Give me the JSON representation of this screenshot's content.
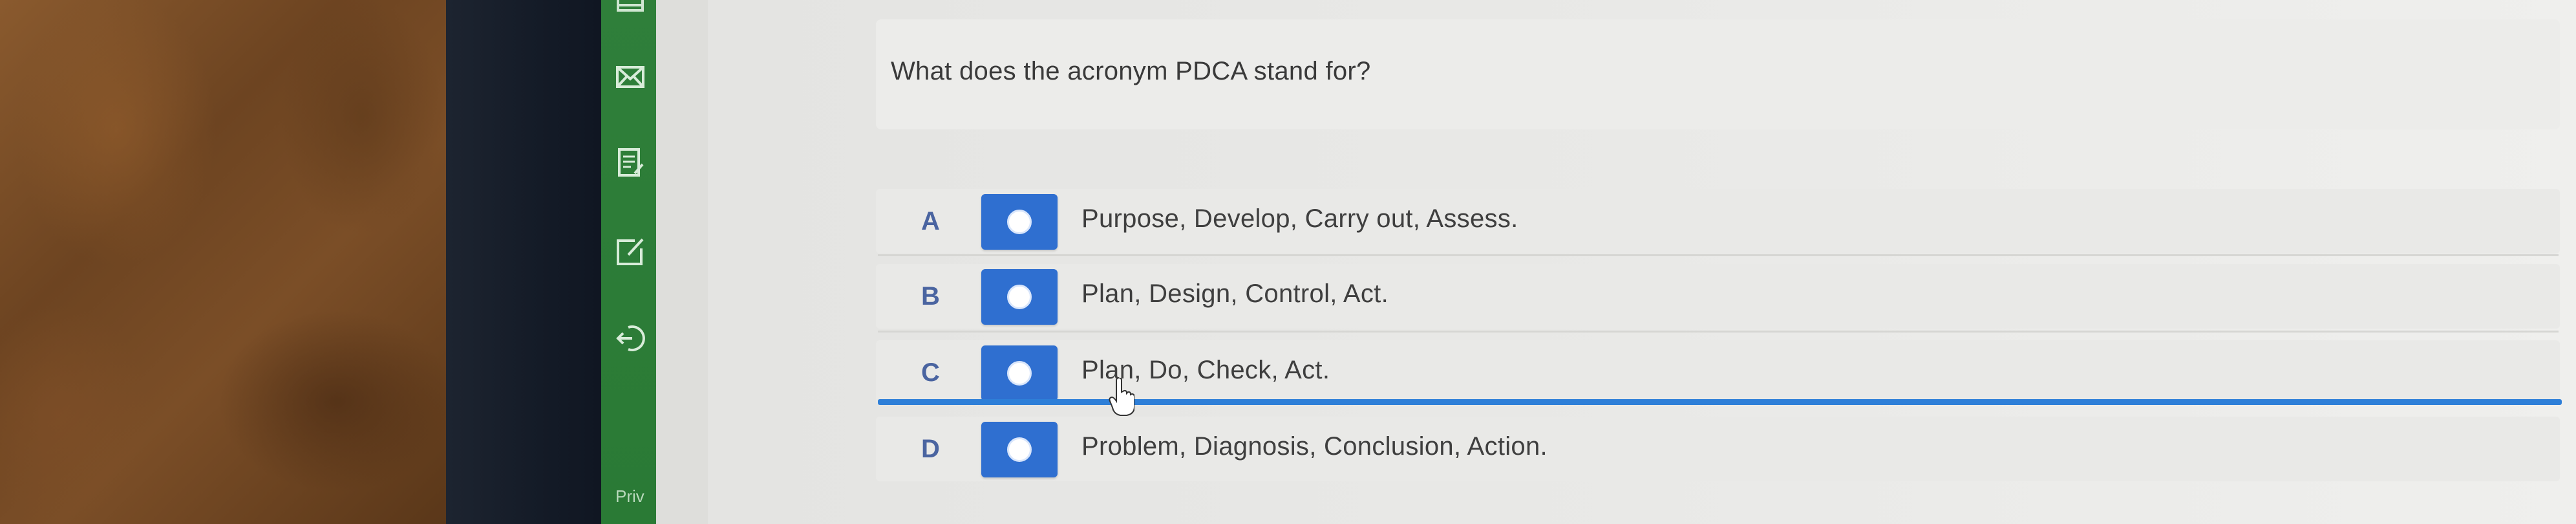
{
  "sidebar": {
    "icons": [
      "calendar-icon",
      "mail-icon",
      "notes-icon",
      "edit-icon",
      "logout-icon"
    ],
    "footer_text": "Priv",
    "color": "#2f7f3a"
  },
  "question": {
    "text": "What does the acronym PDCA stand for?"
  },
  "options": [
    {
      "letter": "A",
      "text": "Purpose, Develop, Carry out, Assess."
    },
    {
      "letter": "B",
      "text": "Plan, Design, Control, Act."
    },
    {
      "letter": "C",
      "text": "Plan, Do, Check, Act."
    },
    {
      "letter": "D",
      "text": "Problem, Diagnosis, Conclusion, Action."
    }
  ],
  "colors": {
    "accent": "#2f6fd0",
    "focus_line": "#2e7fd8",
    "letter": "#4a64a0"
  }
}
